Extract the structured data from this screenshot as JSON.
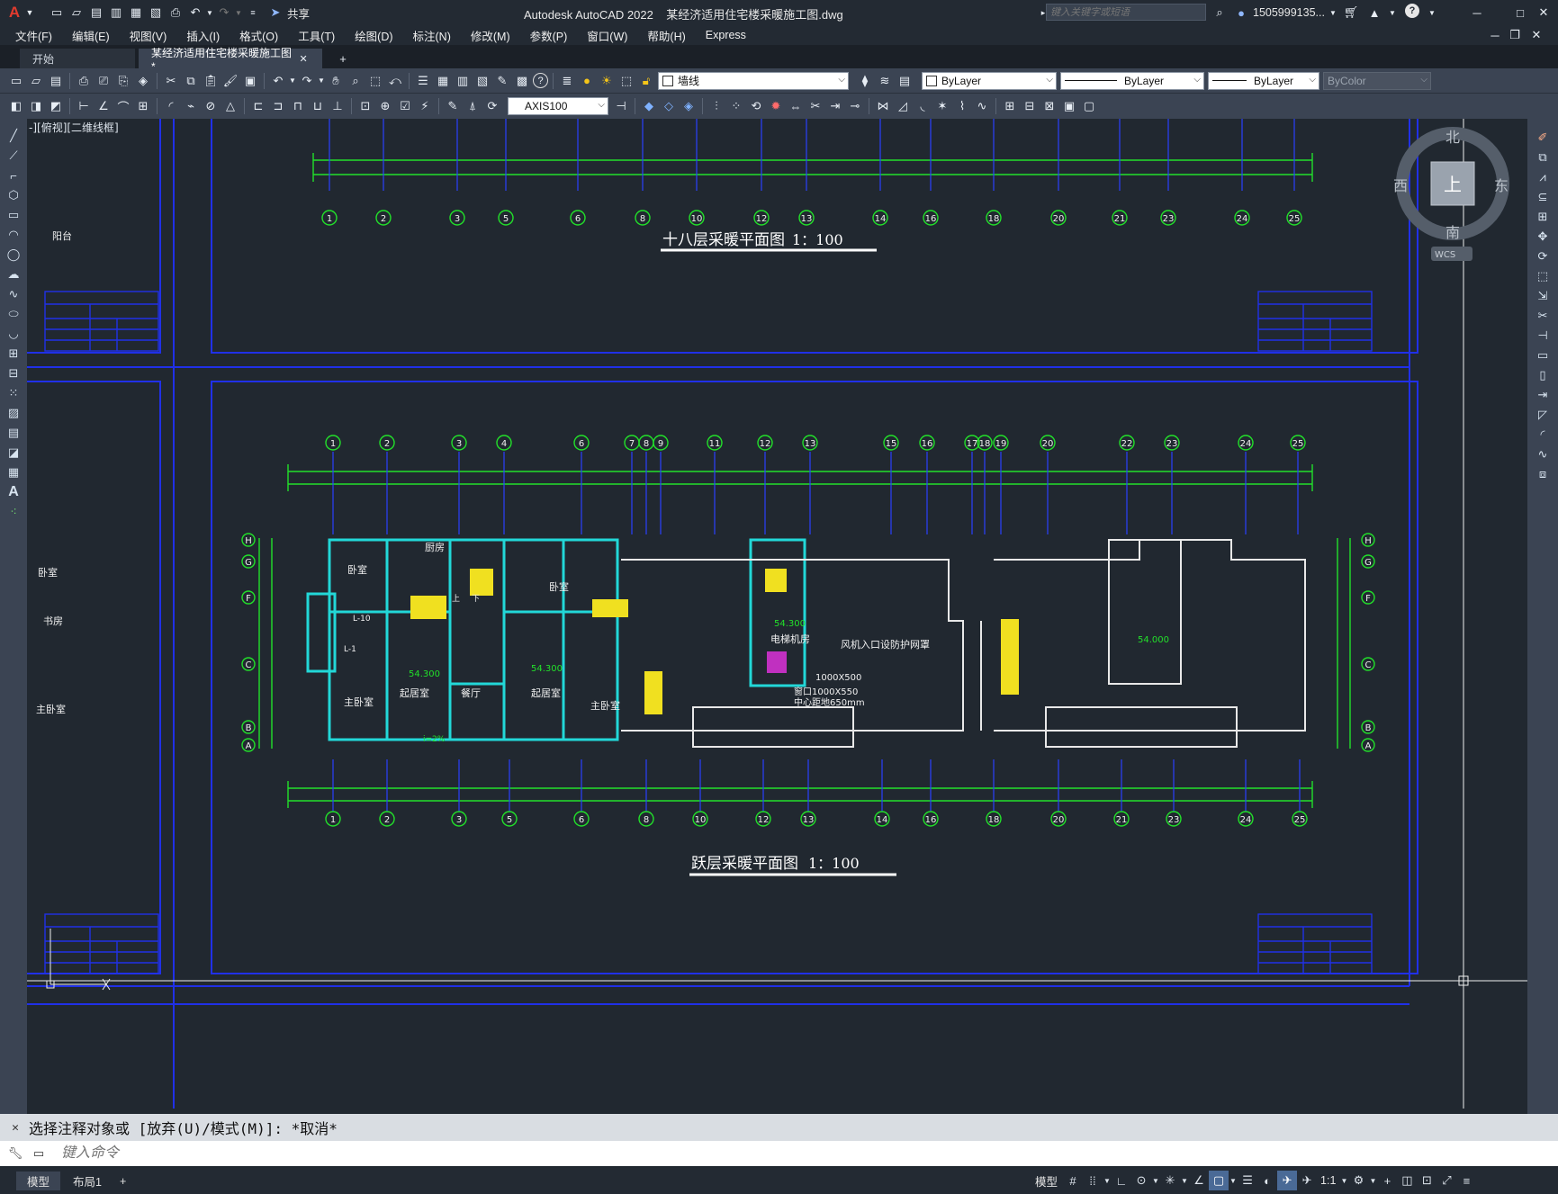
{
  "title_bar": {
    "app_title": "Autodesk AutoCAD 2022",
    "file_title": "某经济适用住宅楼采暖施工图.dwg",
    "share_label": "共享",
    "search_placeholder": "键入关键字或短语",
    "user_label": "1505999135...",
    "help_label": "?"
  },
  "menus": [
    "文件(F)",
    "编辑(E)",
    "视图(V)",
    "插入(I)",
    "格式(O)",
    "工具(T)",
    "绘图(D)",
    "标注(N)",
    "修改(M)",
    "参数(P)",
    "窗口(W)",
    "帮助(H)",
    "Express"
  ],
  "tabs": [
    {
      "label": "开始"
    },
    {
      "label": "某经济适用住宅楼采暖施工图*"
    }
  ],
  "toolbar": {
    "layer_value": "墙线",
    "color_value": "ByLayer",
    "linetype_value": "ByLayer",
    "lineweight_value": "ByLayer",
    "plotstyle_value": "ByColor",
    "dimstyle_value": "AXIS100"
  },
  "viewcube": {
    "north": "北",
    "south": "南",
    "east": "东",
    "west": "西",
    "top": "上",
    "wcs": "WCS"
  },
  "viewport_label": "-][俯视][二维线框]",
  "drawing": {
    "plan_top_title": "十八层采暖平面图",
    "plan_top_scale": "1：100",
    "plan_bottom_title": "跃层采暖平面图",
    "plan_bottom_scale": "1：100",
    "axes_top": [
      "1",
      "2",
      "3",
      "5",
      "6",
      "8",
      "10",
      "12",
      "13",
      "14",
      "16",
      "18",
      "20",
      "21",
      "23",
      "24",
      "25"
    ],
    "axes_mid": [
      "1",
      "2",
      "3",
      "4",
      "6",
      "7",
      "8",
      "9",
      "11",
      "12",
      "13",
      "15",
      "16",
      "17",
      "18",
      "19",
      "20",
      "22",
      "23",
      "24",
      "25"
    ],
    "axes_row": [
      "H",
      "G",
      "F",
      "C",
      "B",
      "A"
    ],
    "rooms": [
      "卧室",
      "主卧室",
      "起居室",
      "餐厅",
      "起居室",
      "卧室",
      "主卧室",
      "电梯机房",
      "阳台",
      "书房",
      "卧室",
      "主卧室"
    ],
    "labels": {
      "elev_1": "54.300",
      "elev_2": "54.300",
      "elev_3": "54.300",
      "elev_4": "54.000",
      "fan_note": "风机入口设防护网罩",
      "dim_note_1": "1000X500",
      "dim_note_2": "窗口1000X550",
      "dim_note_3": "中心距地650mm",
      "kitchen_1": "厨房",
      "stair_1": "上",
      "stair_2": "下",
      "riser_1": "L-10",
      "riser_2": "L-1",
      "slope": "i=2%"
    }
  },
  "command": {
    "history": "选择注释对象或 [放弃(U)/模式(M)]: *取消*",
    "placeholder": "键入命令"
  },
  "status": {
    "tabs": [
      "模型",
      "布局1"
    ],
    "model_label": "模型",
    "scale_label": "1:1"
  }
}
